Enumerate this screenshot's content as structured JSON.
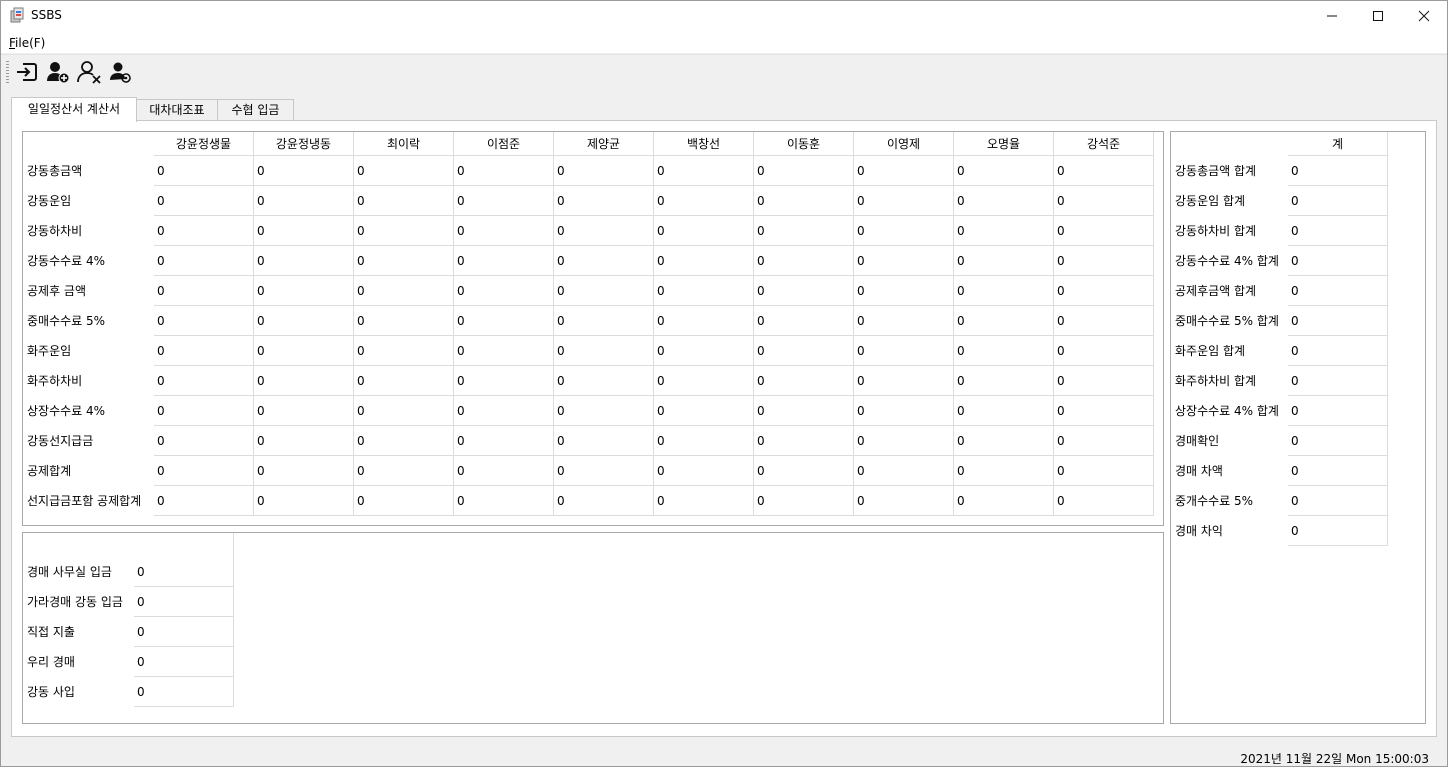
{
  "window": {
    "title": "SSBS"
  },
  "menu": {
    "file": "File(F)",
    "file_accel": "F",
    "file_rest": "ile(F)"
  },
  "toolbar": {
    "buttons": [
      {
        "icon": "login-icon"
      },
      {
        "icon": "user-add-icon"
      },
      {
        "icon": "user-remove-icon"
      },
      {
        "icon": "user-settings-icon"
      }
    ]
  },
  "tabs": [
    {
      "label": "일일정산서 계산서",
      "active": true
    },
    {
      "label": "대차대조표",
      "active": false
    },
    {
      "label": "수협 입금",
      "active": false
    }
  ],
  "main_table": {
    "columns": [
      "강윤정생물",
      "강윤정냉동",
      "최이락",
      "이점준",
      "제양균",
      "백창선",
      "이동훈",
      "이영제",
      "오명율",
      "강석준"
    ],
    "rows": [
      {
        "label": "강동총금액",
        "values": [
          "0",
          "0",
          "0",
          "0",
          "0",
          "0",
          "0",
          "0",
          "0",
          "0"
        ]
      },
      {
        "label": "강동운임",
        "values": [
          "0",
          "0",
          "0",
          "0",
          "0",
          "0",
          "0",
          "0",
          "0",
          "0"
        ]
      },
      {
        "label": "강동하차비",
        "values": [
          "0",
          "0",
          "0",
          "0",
          "0",
          "0",
          "0",
          "0",
          "0",
          "0"
        ]
      },
      {
        "label": "강동수수료 4%",
        "values": [
          "0",
          "0",
          "0",
          "0",
          "0",
          "0",
          "0",
          "0",
          "0",
          "0"
        ]
      },
      {
        "label": "공제후 금액",
        "values": [
          "0",
          "0",
          "0",
          "0",
          "0",
          "0",
          "0",
          "0",
          "0",
          "0"
        ]
      },
      {
        "label": "중매수수료 5%",
        "values": [
          "0",
          "0",
          "0",
          "0",
          "0",
          "0",
          "0",
          "0",
          "0",
          "0"
        ]
      },
      {
        "label": "화주운임",
        "values": [
          "0",
          "0",
          "0",
          "0",
          "0",
          "0",
          "0",
          "0",
          "0",
          "0"
        ]
      },
      {
        "label": "화주하차비",
        "values": [
          "0",
          "0",
          "0",
          "0",
          "0",
          "0",
          "0",
          "0",
          "0",
          "0"
        ]
      },
      {
        "label": "상장수수료 4%",
        "values": [
          "0",
          "0",
          "0",
          "0",
          "0",
          "0",
          "0",
          "0",
          "0",
          "0"
        ]
      },
      {
        "label": "강동선지급금",
        "values": [
          "0",
          "0",
          "0",
          "0",
          "0",
          "0",
          "0",
          "0",
          "0",
          "0"
        ]
      },
      {
        "label": "공제합계",
        "values": [
          "0",
          "0",
          "0",
          "0",
          "0",
          "0",
          "0",
          "0",
          "0",
          "0"
        ]
      },
      {
        "label": "선지급금포함 공제합계",
        "values": [
          "0",
          "0",
          "0",
          "0",
          "0",
          "0",
          "0",
          "0",
          "0",
          "0"
        ]
      }
    ]
  },
  "deposit_table": {
    "rows": [
      {
        "label": "경매 사무실 입금",
        "value": "0"
      },
      {
        "label": "가라경매 강동 입금",
        "value": "0"
      },
      {
        "label": "직접 지출",
        "value": "0"
      },
      {
        "label": "우리 경매",
        "value": "0"
      },
      {
        "label": "강동 사입",
        "value": "0"
      }
    ]
  },
  "totals_table": {
    "header": "계",
    "rows": [
      {
        "label": "강동총금액 합계",
        "value": "0"
      },
      {
        "label": "강동운임 합계",
        "value": "0"
      },
      {
        "label": "강동하차비 합계",
        "value": "0"
      },
      {
        "label": "강동수수료 4% 합계",
        "value": "0"
      },
      {
        "label": "공제후금액 합계",
        "value": "0"
      },
      {
        "label": "중매수수료 5% 합계",
        "value": "0"
      },
      {
        "label": "화주운임 합계",
        "value": "0"
      },
      {
        "label": "화주하차비 합계",
        "value": "0"
      },
      {
        "label": "상장수수료 4% 합계",
        "value": "0"
      },
      {
        "label": "경매확인",
        "value": "0"
      },
      {
        "label": "경매 차액",
        "value": "0"
      },
      {
        "label": "중개수수료 5%",
        "value": "0"
      },
      {
        "label": "경매 차익",
        "value": "0"
      }
    ]
  },
  "status": {
    "datetime": "2021년 11월 22일 Mon 15:00:03"
  }
}
